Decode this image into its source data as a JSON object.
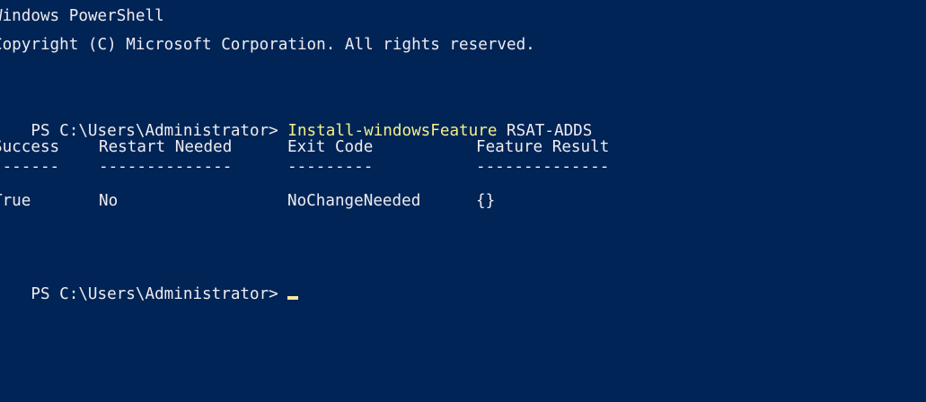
{
  "console": {
    "banner": {
      "line1": "Windows PowerShell",
      "line2": "Copyright (C) Microsoft Corporation. All rights reserved."
    },
    "command_block": {
      "prompt": "PS C:\\Users\\Administrator> ",
      "command": "Install-windowsFeature",
      "argument": " RSAT-ADDS"
    },
    "result_table": {
      "headers": [
        "Success",
        "Restart Needed",
        "Exit Code",
        "Feature Result"
      ],
      "dividers": [
        "-------",
        "--------------",
        "---------",
        "--------------"
      ],
      "rows": [
        [
          "True",
          "No",
          "NoChangeNeeded",
          "{}"
        ]
      ]
    },
    "final_prompt": "PS C:\\Users\\Administrator> ",
    "colors": {
      "background": "#012456",
      "foreground": "#eeedf0",
      "command": "#f3f08a",
      "cursor": "#f6e7a0"
    }
  }
}
